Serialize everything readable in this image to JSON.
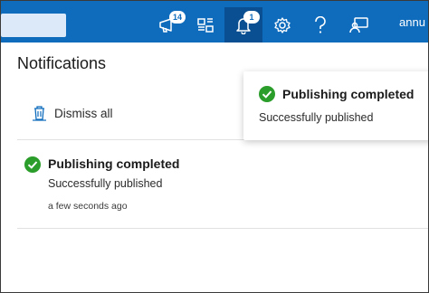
{
  "topbar": {
    "icons": [
      {
        "name": "feedback-megaphone-icon",
        "badge": "14"
      },
      {
        "name": "directory-switch-icon",
        "badge": ""
      },
      {
        "name": "notifications-bell-icon",
        "badge": "1",
        "active": true
      },
      {
        "name": "settings-gear-icon",
        "badge": ""
      },
      {
        "name": "help-question-icon",
        "badge": ""
      },
      {
        "name": "feedback-person-icon",
        "badge": ""
      }
    ],
    "user": "annu"
  },
  "panel": {
    "title": "Notifications",
    "dismiss_label": "Dismiss all"
  },
  "notifications": [
    {
      "title": "Publishing completed",
      "body": "Successfully published",
      "time": "a few seconds ago",
      "status": "success"
    }
  ],
  "toast": {
    "title": "Publishing completed",
    "body": "Successfully published",
    "status": "success"
  },
  "colors": {
    "topbar": "#0f6cbd",
    "active_icon_bg": "#0a4f91",
    "success": "#2a9d2a"
  }
}
